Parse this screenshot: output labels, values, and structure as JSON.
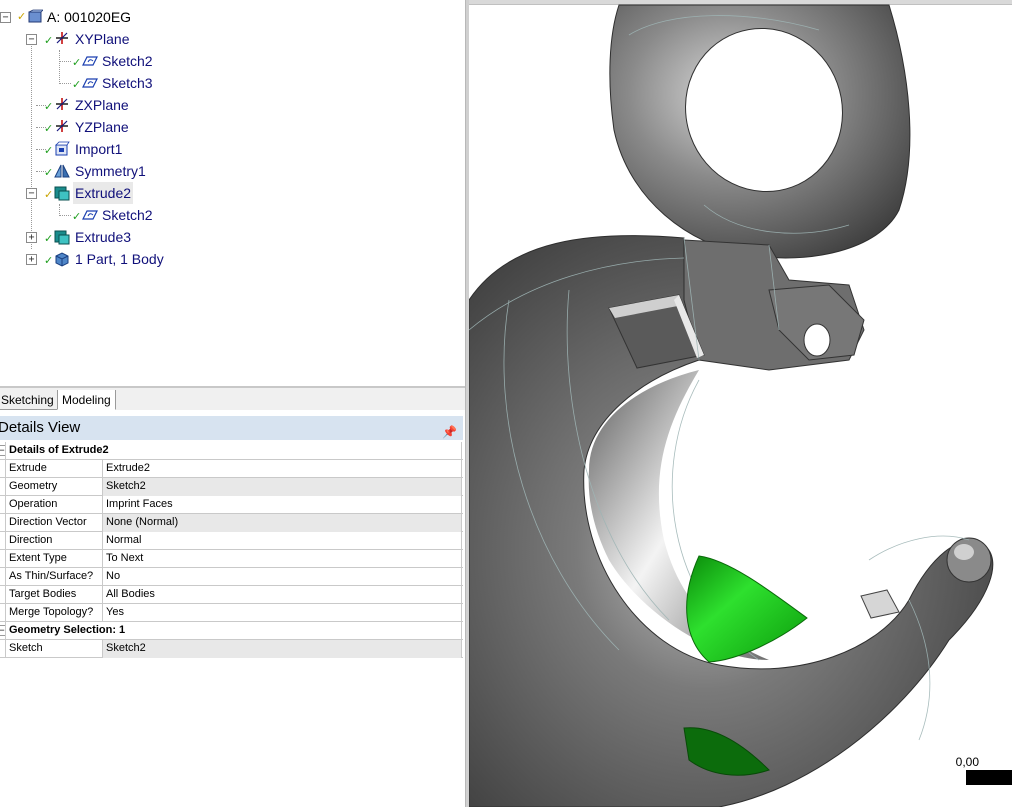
{
  "tree": {
    "root_label": "A: 001020EG",
    "items": [
      {
        "label": "XYPlane",
        "icon": "plane-axes-icon"
      },
      {
        "label": "Sketch2",
        "icon": "sketch-icon"
      },
      {
        "label": "Sketch3",
        "icon": "sketch-icon"
      },
      {
        "label": "ZXPlane",
        "icon": "plane-axes-icon"
      },
      {
        "label": "YZPlane",
        "icon": "plane-axes-icon"
      },
      {
        "label": "Import1",
        "icon": "import-icon"
      },
      {
        "label": "Symmetry1",
        "icon": "symmetry-icon"
      },
      {
        "label": "Extrude2",
        "icon": "extrude-icon"
      },
      {
        "label": "Sketch2",
        "icon": "sketch-icon"
      },
      {
        "label": "Extrude3",
        "icon": "extrude-icon"
      },
      {
        "label": "1 Part, 1 Body",
        "icon": "body-icon"
      }
    ]
  },
  "tabs": {
    "sketching": "Sketching",
    "modeling": "Modeling"
  },
  "details": {
    "title": "Details View",
    "section1": "Details of Extrude2",
    "rows": [
      {
        "key": "Extrude",
        "value": "Extrude2"
      },
      {
        "key": "Geometry",
        "value": "Sketch2"
      },
      {
        "key": "Operation",
        "value": "Imprint Faces"
      },
      {
        "key": "Direction Vector",
        "value": "None (Normal)"
      },
      {
        "key": "Direction",
        "value": "Normal"
      },
      {
        "key": "Extent Type",
        "value": "To Next"
      },
      {
        "key": "As Thin/Surface?",
        "value": "No"
      },
      {
        "key": "Target Bodies",
        "value": "All Bodies"
      },
      {
        "key": "Merge Topology?",
        "value": "Yes"
      }
    ],
    "section2": "Geometry Selection: 1",
    "rows2": [
      {
        "key": "Sketch",
        "value": "Sketch2"
      }
    ]
  },
  "viewport": {
    "scale_label": "0,00",
    "model_color": "#5c5c5c",
    "selection_color": "#12c412"
  },
  "colors": {
    "tree_text": "#10107a",
    "check_green": "#1e9e1e",
    "details_header_bg": "#d7e3f0"
  }
}
